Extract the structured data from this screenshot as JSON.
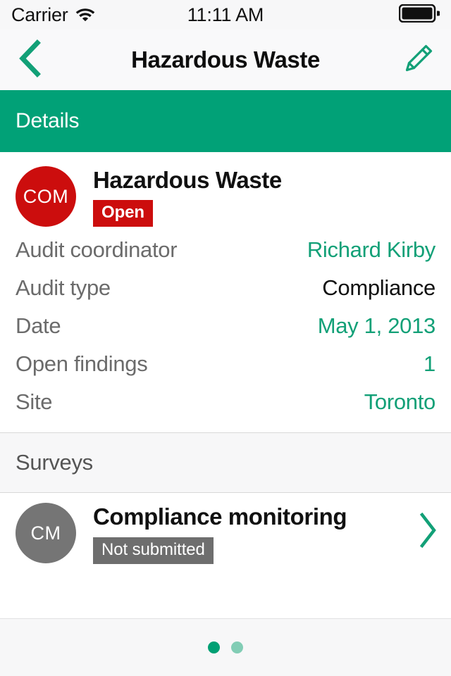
{
  "status_bar": {
    "carrier": "Carrier",
    "wifi_icon": "wifi-icon",
    "time": "11:11 AM",
    "battery_icon": "battery-full-icon"
  },
  "nav_bar": {
    "back_icon": "chevron-left-icon",
    "title": "Hazardous Waste",
    "edit_icon": "pencil-icon"
  },
  "details_section": {
    "header": "Details",
    "entity": {
      "avatar_initials": "COM",
      "avatar_color": "#cc0d0d",
      "name": "Hazardous Waste",
      "status_badge": "Open",
      "status_badge_color": "#cc0d0d"
    },
    "fields": [
      {
        "key": "Audit coordinator",
        "value": "Richard Kirby",
        "value_style": "green"
      },
      {
        "key": "Audit type",
        "value": "Compliance",
        "value_style": "dark"
      },
      {
        "key": "Date",
        "value": "May 1, 2013",
        "value_style": "green"
      },
      {
        "key": "Open findings",
        "value": "1",
        "value_style": "green"
      },
      {
        "key": "Site",
        "value": "Toronto",
        "value_style": "green"
      }
    ]
  },
  "surveys_section": {
    "header": "Surveys",
    "items": [
      {
        "avatar_initials": "CM",
        "avatar_color": "#757575",
        "title": "Compliance monitoring",
        "status_badge": "Not submitted",
        "status_badge_color": "#6e6e6e",
        "chevron_icon": "chevron-right-icon"
      }
    ]
  },
  "pager": {
    "total": 2,
    "active_index": 0,
    "active_color": "#00a074",
    "inactive_color": "#82cdb5"
  },
  "theme": {
    "accent_green": "#01a177",
    "link_green": "#12a077",
    "page_background": "#f7f7f8"
  }
}
